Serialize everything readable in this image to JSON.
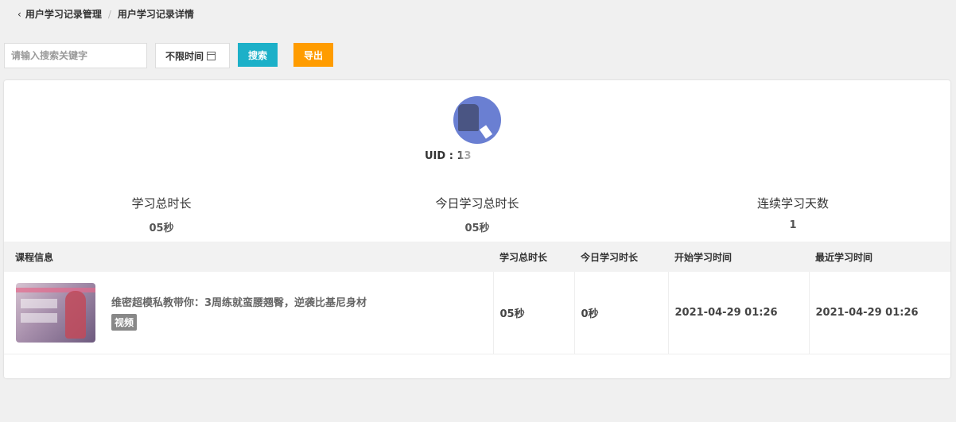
{
  "breadcrumb": {
    "parent": "用户学习记录管理",
    "current": "用户学习记录详情"
  },
  "toolbar": {
    "search_placeholder": "请输入搜索关键字",
    "time_filter": "不限时间",
    "search_label": "搜索",
    "export_label": "导出"
  },
  "user": {
    "uid_label": "UID : 13"
  },
  "stats": [
    {
      "label": "学习总时长",
      "value": "05秒"
    },
    {
      "label": "今日学习总时长",
      "value": "05秒"
    },
    {
      "label": "连续学习天数",
      "value": "1"
    }
  ],
  "table": {
    "headers": [
      "课程信息",
      "学习总时长",
      "今日学习时长",
      "开始学习时间",
      "最近学习时间"
    ],
    "rows": [
      {
        "title": "维密超模私教带你：3周练就蛮腰翘臀，逆袭比基尼身材",
        "tag": "视频",
        "total": "05秒",
        "today": "0秒",
        "start": "2021-04-29 01:26",
        "latest": "2021-04-29 01:26"
      }
    ]
  },
  "colors": {
    "search_button": "#1cb0c8",
    "export_button": "#ff9c00",
    "avatar": "#6a7fd2"
  }
}
